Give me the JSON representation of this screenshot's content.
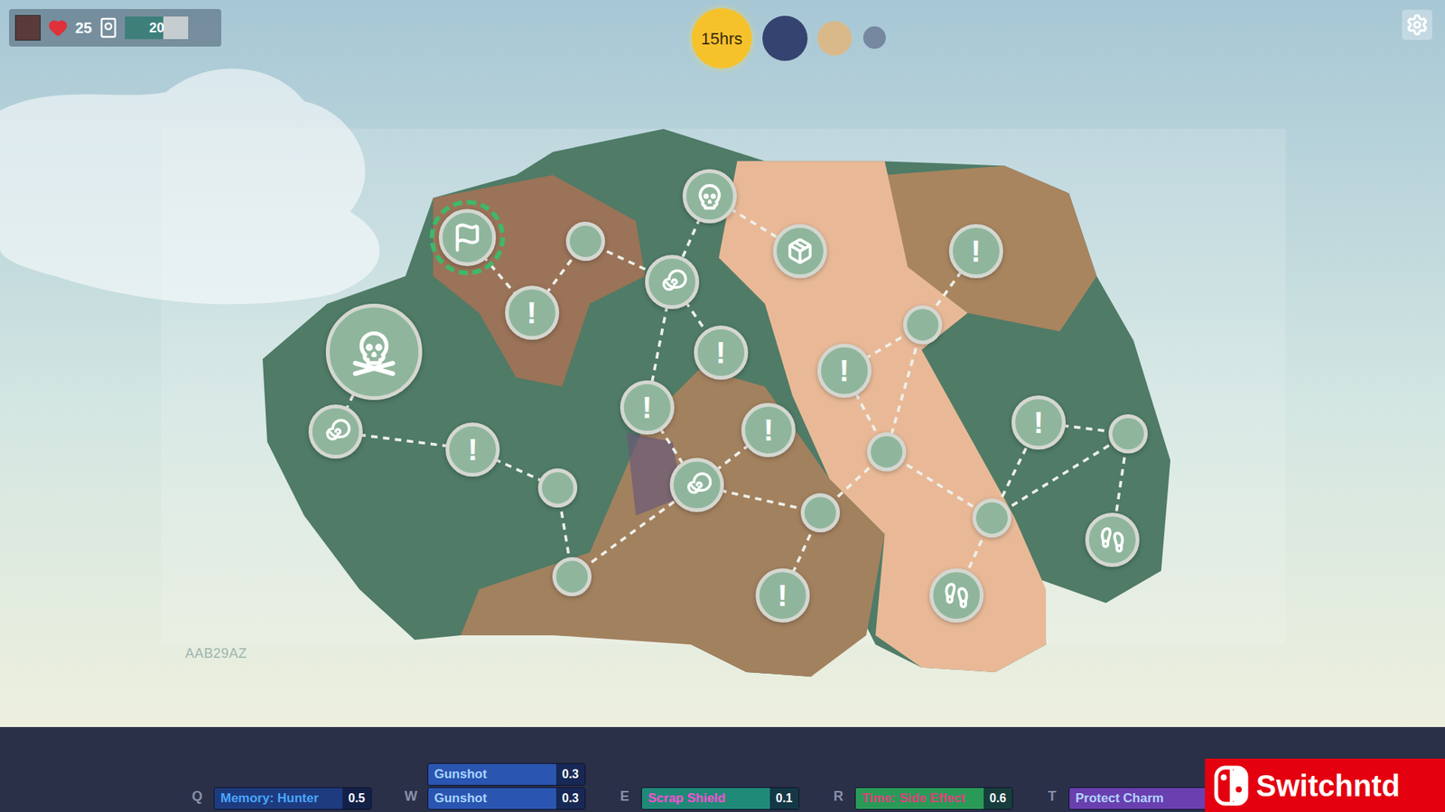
{
  "hud": {
    "health": "25",
    "deck": {
      "value": "20",
      "level": 0.6
    }
  },
  "clock": {
    "label": "15hrs"
  },
  "planets": [
    {
      "color": "#34436f"
    },
    {
      "color": "#d9b98a"
    },
    {
      "color": "#7588a0"
    }
  ],
  "map": {
    "seed": "AAB29AZ",
    "nodes": [
      {
        "kind": "flag",
        "current": true
      },
      {
        "kind": "empty",
        "current": false
      },
      {
        "kind": "alert",
        "glyph": "!",
        "current": false
      },
      {
        "kind": "skull",
        "current": false
      },
      {
        "kind": "chest",
        "current": false
      },
      {
        "kind": "alert",
        "glyph": "!",
        "current": false
      },
      {
        "kind": "swirl",
        "current": false
      },
      {
        "kind": "alert",
        "glyph": "!",
        "current": false
      },
      {
        "kind": "empty",
        "current": false
      },
      {
        "kind": "boss",
        "current": false
      },
      {
        "kind": "alert",
        "glyph": "!",
        "current": false
      },
      {
        "kind": "alert",
        "glyph": "!",
        "current": false
      },
      {
        "kind": "alert",
        "glyph": "!",
        "current": false
      },
      {
        "kind": "alert",
        "glyph": "!",
        "current": false
      },
      {
        "kind": "empty",
        "current": false
      },
      {
        "kind": "swirl",
        "current": false
      },
      {
        "kind": "alert",
        "glyph": "!",
        "current": false
      },
      {
        "kind": "empty",
        "current": false
      },
      {
        "kind": "swirl",
        "current": false
      },
      {
        "kind": "empty",
        "current": false
      },
      {
        "kind": "empty",
        "current": false
      },
      {
        "kind": "empty",
        "current": false
      },
      {
        "kind": "boot",
        "current": false
      },
      {
        "kind": "empty",
        "current": false
      },
      {
        "kind": "alert",
        "glyph": "!",
        "current": false
      },
      {
        "kind": "boot",
        "current": false
      }
    ]
  },
  "skills": [
    {
      "key": "Q",
      "slots": [
        {
          "name": "Memory: Hunter",
          "value": "0.5",
          "color": "#1d3b7e",
          "label_color": "#4aa6ff"
        }
      ]
    },
    {
      "key": "W",
      "slots": [
        {
          "name": "Gunshot",
          "value": "0.3",
          "color": "#2a55b0",
          "label_color": "#a9d4ff"
        },
        {
          "name": "Gunshot",
          "value": "0.3",
          "color": "#2a55b0",
          "label_color": "#a9d4ff"
        }
      ]
    },
    {
      "key": "E",
      "slots": [
        {
          "name": "Scrap Shield",
          "value": "0.1",
          "color": "#1f8a78",
          "label_color": "#ff4fd2"
        }
      ]
    },
    {
      "key": "R",
      "slots": [
        {
          "name": "Time: Side Effect",
          "value": "0.6",
          "color": "#2a9a58",
          "label_color": "#e0407c"
        }
      ]
    },
    {
      "key": "T",
      "slots": [
        {
          "name": "Protect Charm",
          "value": "",
          "color": "#6a3fb0",
          "label_color": "#b0d4ff"
        }
      ]
    }
  ],
  "watermark": "Switchntd"
}
